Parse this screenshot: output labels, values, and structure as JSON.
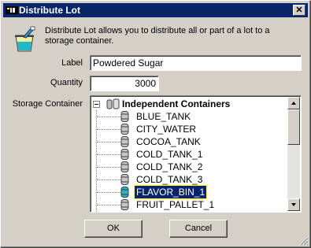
{
  "window": {
    "title": "Distribute Lot"
  },
  "description": "Distribute Lot allows you to distribute all or part of a lot to a storage container.",
  "form": {
    "label_caption": "Label",
    "label_value": "Powdered Sugar",
    "quantity_caption": "Quantity",
    "quantity_value": "3000",
    "storage_caption": "Storage Container"
  },
  "tree": {
    "root": "Independent Containers",
    "items": [
      "BLUE_TANK",
      "CITY_WATER",
      "COCOA_TANK",
      "COLD_TANK_1",
      "COLD_TANK_2",
      "COLD_TANK_3",
      "FLAVOR_BIN_1",
      "FRUIT_PALLET_1"
    ],
    "selected": "FLAVOR_BIN_1"
  },
  "buttons": {
    "ok": "OK",
    "cancel": "Cancel"
  },
  "icons": {
    "app": "app-icon",
    "close": "close-icon",
    "paint": "paint-bucket-icon",
    "tank": "tank-icon",
    "containers": "containers-icon"
  },
  "colors": {
    "titlebar": "#0a246a",
    "selection": "#0a246a",
    "dialog": "#d4d0c8"
  }
}
